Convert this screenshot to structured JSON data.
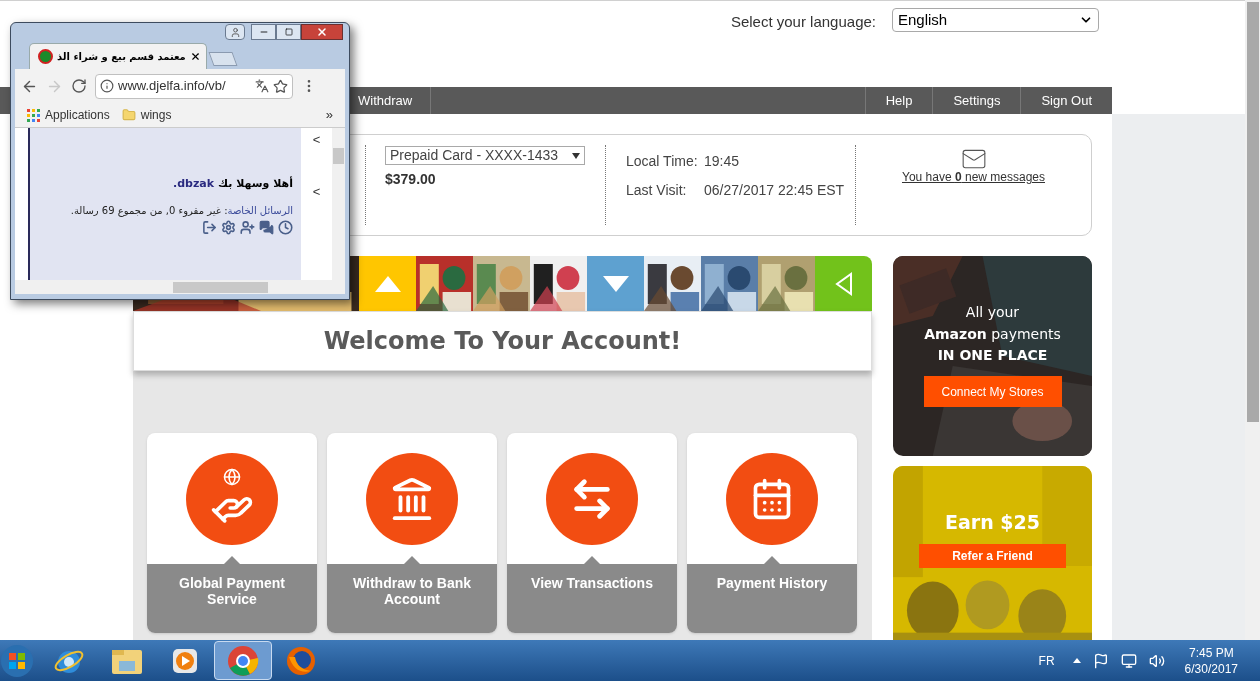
{
  "language": {
    "label": "Select your language:",
    "value": "English"
  },
  "nav": {
    "left": [
      {
        "label": "Withdraw"
      }
    ],
    "right": [
      {
        "label": "Help"
      },
      {
        "label": "Settings"
      },
      {
        "label": "Sign Out"
      }
    ]
  },
  "account": {
    "card": "Prepaid Card - XXXX-1433",
    "balance": "$379.00",
    "local_time_label": "Local Time:",
    "local_time": "19:45",
    "last_visit_label": "Last Visit:",
    "last_visit": "06/27/2017 22:45 EST",
    "messages": "You have **0** new messages"
  },
  "banner": {
    "segments": [
      {
        "kind": "picture"
      },
      {
        "kind": "up",
        "color": "#ffc600"
      },
      {
        "kind": "picture"
      },
      {
        "kind": "picture"
      },
      {
        "kind": "picture"
      },
      {
        "kind": "down",
        "color": "#5ea1d0"
      },
      {
        "kind": "picture"
      },
      {
        "kind": "picture"
      },
      {
        "kind": "picture"
      },
      {
        "kind": "back",
        "color": "#72c21b"
      }
    ],
    "title": "Welcome To Your Account!"
  },
  "tiles": [
    {
      "kind": "globe-hand",
      "label": "Global Payment Service"
    },
    {
      "kind": "bank",
      "label": "Withdraw to Bank Account"
    },
    {
      "kind": "exchange",
      "label": "View Transactions"
    },
    {
      "kind": "calendar",
      "label": "Payment History"
    }
  ],
  "ads": [
    {
      "kind": "amazon",
      "lines": [
        "All your",
        "**Amazon** payments",
        "IN ONE PLACE"
      ],
      "button": "Connect My Stores"
    },
    {
      "kind": "referral",
      "lines": [
        "Earn $25"
      ],
      "button": "Refer a Friend"
    }
  ],
  "popup": {
    "tab_title": "معتمد قسم بيع و شراء الذ",
    "url": "www.djelfa.info/vb/",
    "bookmarks": [
      {
        "kind": "apps",
        "label": "Applications"
      },
      {
        "kind": "folder",
        "label": "wings"
      }
    ],
    "more": "»",
    "greeting": "أهلا وسهلا بك",
    "username": "dbzak.",
    "messages_link": "الرسائل الخاصة",
    "messages_text": ": غير مقروء 0, من مجموع 69 رسالة.",
    "side_marks": [
      "<",
      "<"
    ]
  },
  "taskbar": {
    "apps": [
      {
        "kind": "start",
        "selected": false
      },
      {
        "kind": "ie",
        "selected": false
      },
      {
        "kind": "explorer",
        "selected": false
      },
      {
        "kind": "media",
        "selected": false
      },
      {
        "kind": "chrome",
        "selected": true
      },
      {
        "kind": "firefox",
        "selected": false
      }
    ],
    "language": "FR",
    "time": "7:45 PM",
    "date": "6/30/2017"
  }
}
